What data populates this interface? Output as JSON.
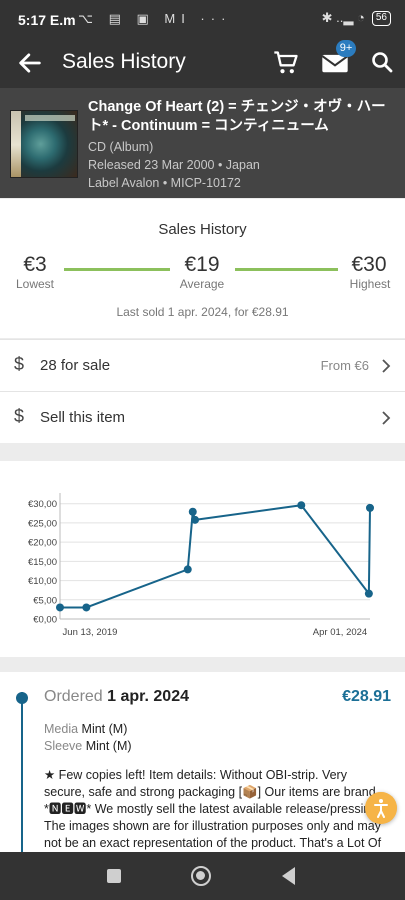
{
  "status_bar": {
    "time": "5:17",
    "carrier": "E.m",
    "left_icons": "⌥ ▤ ▣ MI ···",
    "right_icons": "✱ ..▂ ◔",
    "battery": "56"
  },
  "app_bar": {
    "title": "Sales History",
    "mail_badge": "9+"
  },
  "release": {
    "title": "Change Of Heart (2) = チェンジ・オヴ・ハート* - Continuum = コンティニューム",
    "format": "CD (Album)",
    "released": "Released 23 Mar 2000  • Japan",
    "label": "Label Avalon • MICP-10172"
  },
  "summary": {
    "title": "Sales History",
    "lowest_value": "€3",
    "lowest_label": "Lowest",
    "average_value": "€19",
    "average_label": "Average",
    "highest_value": "€30",
    "highest_label": "Highest",
    "last_sold": "Last sold 1 apr. 2024, for €28.91"
  },
  "for_sale": {
    "label": "28 for sale",
    "from": "From €6"
  },
  "sell": {
    "label": "Sell this item"
  },
  "chart_data": {
    "type": "line",
    "y_ticks": [
      "€30,00",
      "€25,00",
      "€20,00",
      "€15,00",
      "€10,00",
      "€5,00",
      "€0,00"
    ],
    "ylim": [
      0,
      32
    ],
    "x_tick_labels": [
      "Jun 13, 2019",
      "Apr 01, 2024"
    ],
    "grid": true,
    "color": "#17648a",
    "points": [
      {
        "x": "2019-01-01",
        "y": 3.0
      },
      {
        "x": "2019-06-13",
        "y": 3.0
      },
      {
        "x": "2021-03-01",
        "y": 12.9
      },
      {
        "x": "2021-04-01",
        "y": 27.9
      },
      {
        "x": "2021-04-15",
        "y": 25.8
      },
      {
        "x": "2023-02-01",
        "y": 29.6
      },
      {
        "x": "2024-03-25",
        "y": 6.6
      },
      {
        "x": "2024-04-01",
        "y": 28.91
      }
    ]
  },
  "order": {
    "ordered_label": "Ordered",
    "date": "1 apr. 2024",
    "price": "€28.91",
    "media_label": "Media",
    "media_value": "Mint (M)",
    "sleeve_label": "Sleeve",
    "sleeve_value": "Mint (M)",
    "comments": "★ Few copies left! Item details: Without OBI-strip. Very secure, safe and strong packaging [📦] Our items are brand *🅽🅴🆆* We mostly sell the latest available release/pressing. The images shown are for illustration purposes only and may not be an exact representation of the product. That's a Lot Of Music!"
  }
}
